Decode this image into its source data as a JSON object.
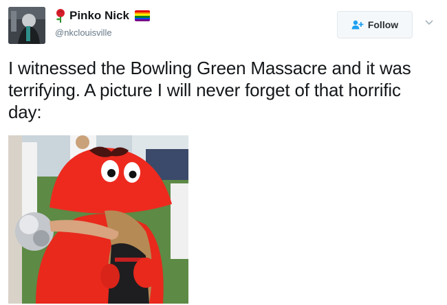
{
  "user": {
    "display_name": "Pinko Nick",
    "handle": "@nkclouisville",
    "name_emoji": [
      "rose-icon",
      "rainbow-flag-icon"
    ]
  },
  "follow": {
    "label": "Follow",
    "icon": "add-user-icon"
  },
  "tweet": {
    "text": "I witnessed the Bowling Green Massacre and it was terrifying. A picture I will never forget of that horrific day:"
  },
  "colors": {
    "text": "#14171a",
    "muted": "#657786",
    "follow_bg": "#f5f8fa",
    "follow_icon": "#1da1f2",
    "mascot_red": "#e8291c"
  }
}
